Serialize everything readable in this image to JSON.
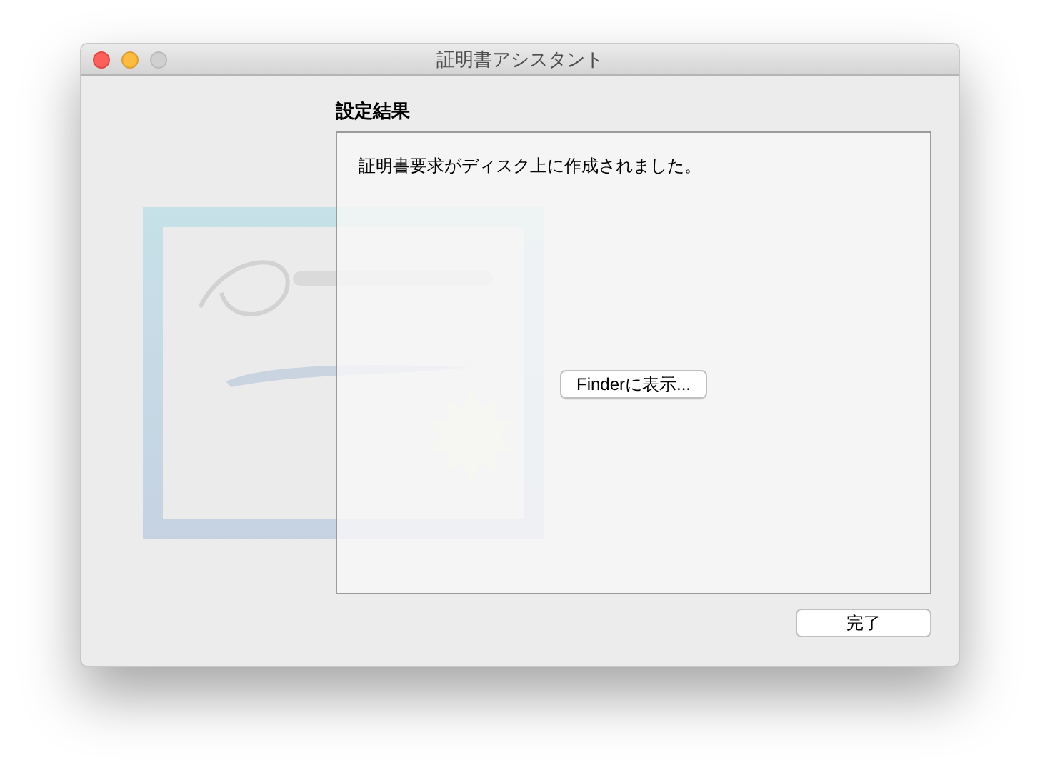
{
  "window": {
    "title": "証明書アシスタント"
  },
  "heading": "設定結果",
  "message": "証明書要求がディスク上に作成されました。",
  "show_button": "Finderに表示...",
  "done_button": "完了"
}
